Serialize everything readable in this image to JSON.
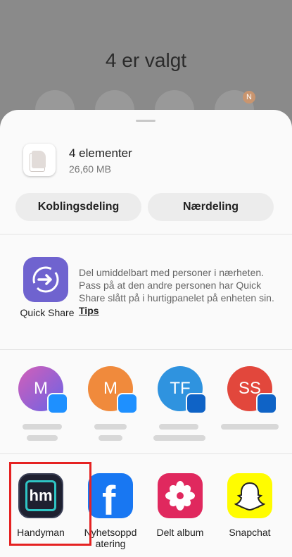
{
  "header": {
    "selection_title": "4 er valgt",
    "badge": "N"
  },
  "file": {
    "title": "4 elementer",
    "size": "26,60 MB"
  },
  "actions": {
    "link_share": "Koblingsdeling",
    "nearby_share": "Nærdeling"
  },
  "quick_share": {
    "label": "Quick Share",
    "description": "Del umiddelbart med personer i nærheten. Pass på at den andre personen har Quick Share slått på i hurtigpanelet på enheten sin.",
    "tips": "Tips"
  },
  "contacts": [
    {
      "initials": "M",
      "color": "#8a5fd6",
      "app_icon": "messages-icon"
    },
    {
      "initials": "M",
      "color": "#f08a3c",
      "app_icon": "messages-icon"
    },
    {
      "initials": "TF",
      "color": "#2f93df",
      "app_icon": "outlook-icon"
    },
    {
      "initials": "SS",
      "color": "#e2473c",
      "app_icon": "outlook-icon"
    }
  ],
  "apps": [
    {
      "label": "Handyman",
      "icon": "handyman-icon",
      "color": "#1e2030"
    },
    {
      "label": "Nyhetsoppd atering",
      "icon": "facebook-icon",
      "color": "#1877f2"
    },
    {
      "label": "Delt album",
      "icon": "flower-icon",
      "color": "#e0285e"
    },
    {
      "label": "Snapchat",
      "icon": "snapchat-icon",
      "color": "#fffc00"
    }
  ],
  "colors": {
    "accent": "#6f63cf",
    "highlight": "#e52222"
  }
}
